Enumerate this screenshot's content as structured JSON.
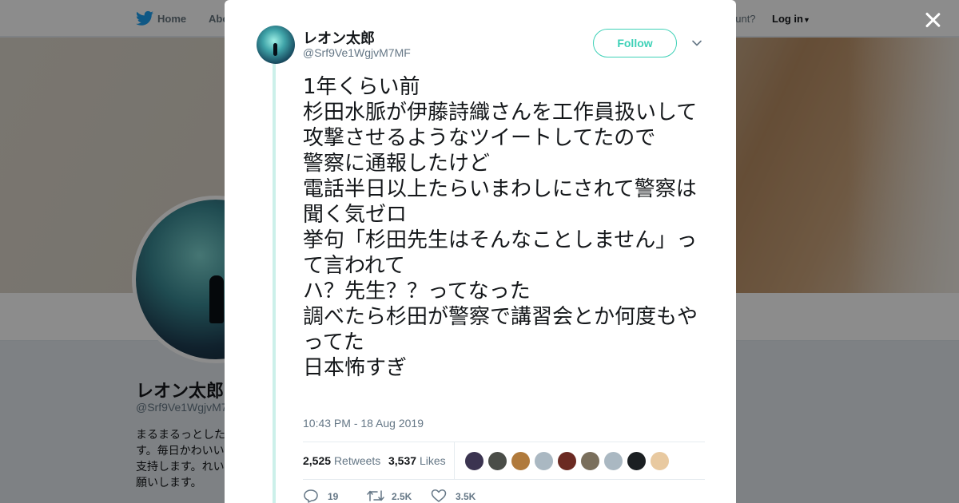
{
  "topbar": {
    "home_label": "Home",
    "about_label": "Abo",
    "account_text": "ccount?",
    "login_label": "Log in"
  },
  "profile": {
    "name": "レオン太郎",
    "handle": "@Srf9Ve1WgjvM7",
    "bio": "まるまるっとした\nす。毎日かわいい\n支持します。れい\n願いします。"
  },
  "tweet": {
    "author_name": "レオン太郎",
    "author_handle": "@Srf9Ve1WgjvM7MF",
    "follow_label": "Follow",
    "text": "1年くらい前\n杉田水脈が伊藤詩織さんを工作員扱いして\n攻撃させるようなツイートしてたので\n警察に通報したけど\n電話半日以上たらいまわしにされて警察は聞く気ゼロ\n挙句「杉田先生はそんなことしません」って言われて\nハ？先生？？ってなった\n調べたら杉田が警察で講習会とか何度もやってた\n日本怖すぎ",
    "timestamp": "10:43 PM - 18 Aug 2019",
    "retweet_count": "2,525",
    "retweet_label": "Retweets",
    "like_count": "3,537",
    "like_label": "Likes",
    "reply_action_count": "19",
    "retweet_action_count": "2.5K",
    "like_action_count": "3.5K"
  },
  "liker_avatars": [
    {
      "name": "liker-avatar-1",
      "color": "#3b3450"
    },
    {
      "name": "liker-avatar-2",
      "color": "#4a4d48"
    },
    {
      "name": "liker-avatar-3",
      "color": "#b07a3c"
    },
    {
      "name": "liker-avatar-4",
      "color": "#aab8c2"
    },
    {
      "name": "liker-avatar-5",
      "color": "#6b2a22"
    },
    {
      "name": "liker-avatar-6",
      "color": "#7a6f5c"
    },
    {
      "name": "liker-avatar-7",
      "color": "#aab8c2"
    },
    {
      "name": "liker-avatar-8",
      "color": "#1b1f22"
    },
    {
      "name": "liker-avatar-9",
      "color": "#e8c9a0"
    }
  ],
  "colors": {
    "accent": "#3ed1b7",
    "text_primary": "#14171a",
    "text_secondary": "#657786",
    "twitter_blue": "#1da1f2"
  }
}
